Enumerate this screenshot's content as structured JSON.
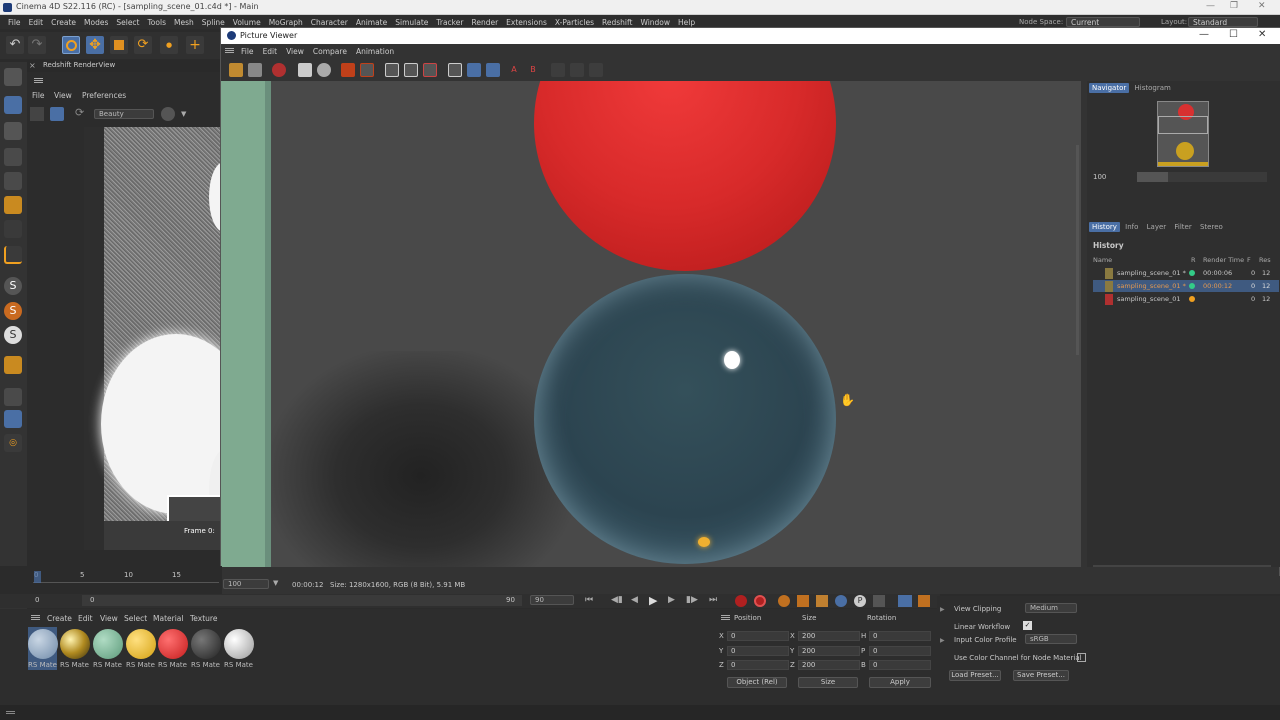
{
  "app": {
    "window_title": "Cinema 4D S22.116 (RC) - [sampling_scene_01.c4d *] - Main",
    "menu": [
      "File",
      "Edit",
      "Create",
      "Modes",
      "Select",
      "Tools",
      "Mesh",
      "Spline",
      "Volume",
      "MoGraph",
      "Character",
      "Animate",
      "Simulate",
      "Tracker",
      "Render",
      "Extensions",
      "X-Particles",
      "Redshift",
      "Window",
      "Help"
    ],
    "node_space_label": "Node Space:",
    "node_space_value": "Current (Redshift)",
    "layout_label": "Layout:",
    "layout_value": "Standard"
  },
  "rs_view": {
    "title": "Redshift RenderView",
    "menu": [
      "File",
      "View",
      "Preferences"
    ],
    "aov_value": "Beauty",
    "frame_label": "Frame 0:"
  },
  "picture_viewer": {
    "title": "Picture Viewer",
    "menu": [
      "File",
      "Edit",
      "View",
      "Compare",
      "Animation"
    ],
    "navigator_tabs": [
      "Navigator",
      "Histogram"
    ],
    "zoom_value": "100",
    "info_tabs": [
      "History",
      "Info",
      "Layer",
      "Filter",
      "Stereo"
    ],
    "history_heading": "History",
    "history_columns": [
      "Name",
      "R",
      "Render Time",
      "F",
      "Res"
    ],
    "history_rows": [
      {
        "name": "sampling_scene_01 *",
        "time": "00:00:06",
        "f": "0",
        "res": "12",
        "dot": "#33cc88"
      },
      {
        "name": "sampling_scene_01 *",
        "time": "00:00:12",
        "f": "0",
        "res": "12",
        "dot": "#33cc88"
      },
      {
        "name": "sampling_scene_01",
        "time": "",
        "f": "0",
        "res": "12",
        "dot": "#f0a020"
      }
    ],
    "status_zoom": "100",
    "status_time": "00:00:12",
    "status_info": "Size: 1280x1600, RGB (8 Bit), 5.91 MB"
  },
  "timeline": {
    "ticks": [
      "0",
      "5",
      "10",
      "15"
    ],
    "start_frame": "0",
    "start_field": "0",
    "end_label": "90",
    "end_field": "90"
  },
  "materials": {
    "menu": [
      "Create",
      "Edit",
      "View",
      "Select",
      "Material",
      "Texture"
    ],
    "items": [
      {
        "label": "RS Mate",
        "color": "#8fa7c2"
      },
      {
        "label": "RS Mate",
        "color": "#b89a2a"
      },
      {
        "label": "RS Mate",
        "color": "#6fae8e"
      },
      {
        "label": "RS Mate",
        "color": "#e2b020"
      },
      {
        "label": "RS Mate",
        "color": "#d42a2a"
      },
      {
        "label": "RS Mate",
        "color": "#444444"
      },
      {
        "label": "RS Mate",
        "color": "#cccccc"
      }
    ]
  },
  "coords": {
    "headers": [
      "Position",
      "Size",
      "Rotation"
    ],
    "rows": [
      {
        "axis": "X",
        "pos": "0",
        "size_axis": "X",
        "size": "200",
        "rot_axis": "H",
        "rot": "0"
      },
      {
        "axis": "Y",
        "pos": "0",
        "size_axis": "Y",
        "size": "200",
        "rot_axis": "P",
        "rot": "0"
      },
      {
        "axis": "Z",
        "pos": "0",
        "size_axis": "Z",
        "size": "200",
        "rot_axis": "B",
        "rot": "0"
      }
    ],
    "object_mode": "Object (Rel)",
    "size_mode": "Size",
    "apply_label": "Apply"
  },
  "attributes": {
    "view_clipping_label": "View Clipping",
    "view_clipping_value": "Medium",
    "linear_workflow_label": "Linear Workflow",
    "input_color_profile_label": "Input Color Profile",
    "input_color_profile_value": "sRGB",
    "use_color_channel_label": "Use Color Channel for Node Material",
    "load_preset": "Load Preset...",
    "save_preset": "Save Preset..."
  }
}
